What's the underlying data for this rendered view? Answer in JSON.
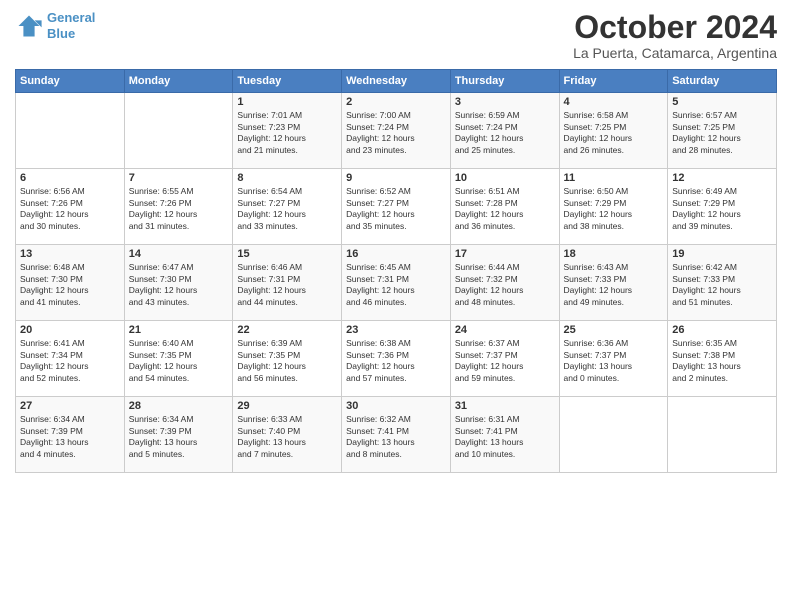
{
  "header": {
    "logo_line1": "General",
    "logo_line2": "Blue",
    "month": "October 2024",
    "location": "La Puerta, Catamarca, Argentina"
  },
  "days_of_week": [
    "Sunday",
    "Monday",
    "Tuesday",
    "Wednesday",
    "Thursday",
    "Friday",
    "Saturday"
  ],
  "weeks": [
    [
      {
        "day": "",
        "info": ""
      },
      {
        "day": "",
        "info": ""
      },
      {
        "day": "1",
        "info": "Sunrise: 7:01 AM\nSunset: 7:23 PM\nDaylight: 12 hours\nand 21 minutes."
      },
      {
        "day": "2",
        "info": "Sunrise: 7:00 AM\nSunset: 7:24 PM\nDaylight: 12 hours\nand 23 minutes."
      },
      {
        "day": "3",
        "info": "Sunrise: 6:59 AM\nSunset: 7:24 PM\nDaylight: 12 hours\nand 25 minutes."
      },
      {
        "day": "4",
        "info": "Sunrise: 6:58 AM\nSunset: 7:25 PM\nDaylight: 12 hours\nand 26 minutes."
      },
      {
        "day": "5",
        "info": "Sunrise: 6:57 AM\nSunset: 7:25 PM\nDaylight: 12 hours\nand 28 minutes."
      }
    ],
    [
      {
        "day": "6",
        "info": "Sunrise: 6:56 AM\nSunset: 7:26 PM\nDaylight: 12 hours\nand 30 minutes."
      },
      {
        "day": "7",
        "info": "Sunrise: 6:55 AM\nSunset: 7:26 PM\nDaylight: 12 hours\nand 31 minutes."
      },
      {
        "day": "8",
        "info": "Sunrise: 6:54 AM\nSunset: 7:27 PM\nDaylight: 12 hours\nand 33 minutes."
      },
      {
        "day": "9",
        "info": "Sunrise: 6:52 AM\nSunset: 7:27 PM\nDaylight: 12 hours\nand 35 minutes."
      },
      {
        "day": "10",
        "info": "Sunrise: 6:51 AM\nSunset: 7:28 PM\nDaylight: 12 hours\nand 36 minutes."
      },
      {
        "day": "11",
        "info": "Sunrise: 6:50 AM\nSunset: 7:29 PM\nDaylight: 12 hours\nand 38 minutes."
      },
      {
        "day": "12",
        "info": "Sunrise: 6:49 AM\nSunset: 7:29 PM\nDaylight: 12 hours\nand 39 minutes."
      }
    ],
    [
      {
        "day": "13",
        "info": "Sunrise: 6:48 AM\nSunset: 7:30 PM\nDaylight: 12 hours\nand 41 minutes."
      },
      {
        "day": "14",
        "info": "Sunrise: 6:47 AM\nSunset: 7:30 PM\nDaylight: 12 hours\nand 43 minutes."
      },
      {
        "day": "15",
        "info": "Sunrise: 6:46 AM\nSunset: 7:31 PM\nDaylight: 12 hours\nand 44 minutes."
      },
      {
        "day": "16",
        "info": "Sunrise: 6:45 AM\nSunset: 7:31 PM\nDaylight: 12 hours\nand 46 minutes."
      },
      {
        "day": "17",
        "info": "Sunrise: 6:44 AM\nSunset: 7:32 PM\nDaylight: 12 hours\nand 48 minutes."
      },
      {
        "day": "18",
        "info": "Sunrise: 6:43 AM\nSunset: 7:33 PM\nDaylight: 12 hours\nand 49 minutes."
      },
      {
        "day": "19",
        "info": "Sunrise: 6:42 AM\nSunset: 7:33 PM\nDaylight: 12 hours\nand 51 minutes."
      }
    ],
    [
      {
        "day": "20",
        "info": "Sunrise: 6:41 AM\nSunset: 7:34 PM\nDaylight: 12 hours\nand 52 minutes."
      },
      {
        "day": "21",
        "info": "Sunrise: 6:40 AM\nSunset: 7:35 PM\nDaylight: 12 hours\nand 54 minutes."
      },
      {
        "day": "22",
        "info": "Sunrise: 6:39 AM\nSunset: 7:35 PM\nDaylight: 12 hours\nand 56 minutes."
      },
      {
        "day": "23",
        "info": "Sunrise: 6:38 AM\nSunset: 7:36 PM\nDaylight: 12 hours\nand 57 minutes."
      },
      {
        "day": "24",
        "info": "Sunrise: 6:37 AM\nSunset: 7:37 PM\nDaylight: 12 hours\nand 59 minutes."
      },
      {
        "day": "25",
        "info": "Sunrise: 6:36 AM\nSunset: 7:37 PM\nDaylight: 13 hours\nand 0 minutes."
      },
      {
        "day": "26",
        "info": "Sunrise: 6:35 AM\nSunset: 7:38 PM\nDaylight: 13 hours\nand 2 minutes."
      }
    ],
    [
      {
        "day": "27",
        "info": "Sunrise: 6:34 AM\nSunset: 7:39 PM\nDaylight: 13 hours\nand 4 minutes."
      },
      {
        "day": "28",
        "info": "Sunrise: 6:34 AM\nSunset: 7:39 PM\nDaylight: 13 hours\nand 5 minutes."
      },
      {
        "day": "29",
        "info": "Sunrise: 6:33 AM\nSunset: 7:40 PM\nDaylight: 13 hours\nand 7 minutes."
      },
      {
        "day": "30",
        "info": "Sunrise: 6:32 AM\nSunset: 7:41 PM\nDaylight: 13 hours\nand 8 minutes."
      },
      {
        "day": "31",
        "info": "Sunrise: 6:31 AM\nSunset: 7:41 PM\nDaylight: 13 hours\nand 10 minutes."
      },
      {
        "day": "",
        "info": ""
      },
      {
        "day": "",
        "info": ""
      }
    ]
  ]
}
